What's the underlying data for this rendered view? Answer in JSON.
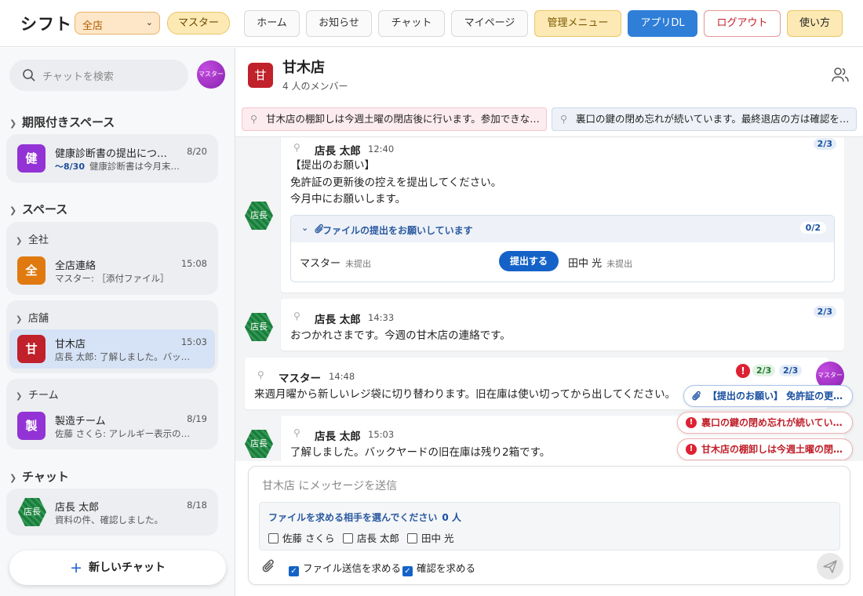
{
  "app": {
    "logo": "シフト",
    "store_select": "全店",
    "role_badge": "マスター"
  },
  "nav": [
    {
      "label": "ホーム"
    },
    {
      "label": "お知らせ"
    },
    {
      "label": "チャット"
    },
    {
      "label": "マイページ"
    },
    {
      "label": "管理メニュー"
    },
    {
      "label": "アプリDL"
    },
    {
      "label": "ログアウト"
    },
    {
      "label": "使い方"
    }
  ],
  "sidebar": {
    "search_placeholder": "チャットを検索",
    "avatar_label": "マスター",
    "limited": {
      "title": "期限付きスペース",
      "room": {
        "icon": "健",
        "name": "健康診断書の提出につ…",
        "time": "8/20",
        "deadline": "〜8/30",
        "preview": "健康診断書は今月末…"
      }
    },
    "spaces": {
      "title": "スペース",
      "groups": [
        {
          "title": "全社",
          "rooms": [
            {
              "icon": "全",
              "name": "全店連絡",
              "time": "15:08",
              "preview": "マスター: ［添付ファイル］"
            }
          ]
        },
        {
          "title": "店舗",
          "rooms": [
            {
              "icon": "甘",
              "name": "甘木店",
              "time": "15:03",
              "preview": "店長 太郎: 了解しました。バッ…"
            }
          ]
        },
        {
          "title": "チーム",
          "rooms": [
            {
              "icon": "製",
              "name": "製造チーム",
              "time": "8/19",
              "preview": "佐藤 さくら: アレルギー表示の…"
            }
          ]
        }
      ]
    },
    "chats": {
      "title": "チャット",
      "room": {
        "icon": "店長",
        "name": "店長 太郎",
        "time": "8/18",
        "preview": "資料の件、確認しました。"
      }
    },
    "new_chat": "新しいチャット"
  },
  "room": {
    "icon": "甘",
    "title": "甘木店",
    "members": "4 人のメンバー",
    "pins": [
      {
        "text": "甘木店の棚卸しは今週土曜の閉店後に行います。参加できな…"
      },
      {
        "text": "裏口の鍵の閉め忘れが続いています。最終退店の方は確認を…"
      }
    ]
  },
  "messages": [
    {
      "sender": "店長 太郎",
      "time": "12:40",
      "body": "【提出のお願い】\n免許証の更新後の控えを提出してください。\n今月中にお願いします。",
      "read": "2/3",
      "avatar": "店長",
      "file_request": {
        "title": "ファイルの提出をお願いしています",
        "count": "0/2",
        "submit_label": "提出する",
        "assignees": [
          {
            "name": "マスター",
            "status": "未提出"
          },
          {
            "name": "田中 光",
            "status": "未提出"
          }
        ]
      }
    },
    {
      "sender": "店長 太郎",
      "time": "14:33",
      "body": "おつかれさまです。今週の甘木店の連絡です。",
      "read": "2/3",
      "avatar": "店長"
    },
    {
      "sender": "マスター",
      "time": "14:48",
      "body": "来週月曜から新しいレジ袋に切り替わります。旧在庫は使い切ってから出してください。",
      "read_confirm": "2/3",
      "read": "2/3",
      "alert": "!",
      "avatar": "マスター"
    },
    {
      "sender": "店長 太郎",
      "time": "15:03",
      "body": "了解しました。バックヤードの旧在庫は残り2箱です。",
      "avatar": "店長"
    }
  ],
  "toasts": [
    {
      "text": "【提出のお願い】 免許証の更…",
      "kind": "file"
    },
    {
      "text": "裏口の鍵の閉め忘れが続いてい…",
      "kind": "alert"
    },
    {
      "text": "甘木店の棚卸しは今週土曜の閉…",
      "kind": "alert"
    }
  ],
  "composer": {
    "placeholder": "甘木店 にメッセージを送信",
    "picker_title": "ファイルを求める相手を選んでください",
    "picker_count": "0 人",
    "candidates": [
      "佐藤 さくら",
      "店長 太郎",
      "田中 光"
    ],
    "opt_file": "ファイル送信を求める",
    "opt_confirm": "確認を求める"
  },
  "colors": {
    "accent": "#1462c8",
    "room_red": "#c0212a",
    "health_purple": "#9333d6",
    "all_orange": "#e07a10",
    "team_purple": "#9333d6"
  }
}
